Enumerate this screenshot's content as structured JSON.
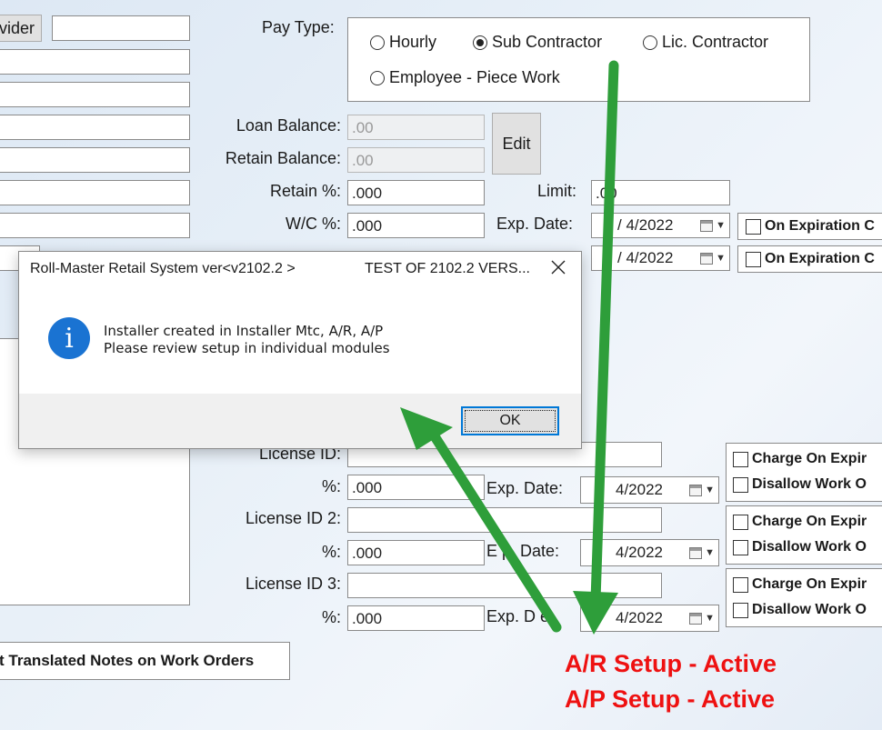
{
  "left": {
    "provider_label": "vider",
    "translated_notes_label": "t Translated Notes on Work Orders"
  },
  "pay_type": {
    "label": "Pay Type:",
    "options": [
      "Hourly",
      "Sub Contractor",
      "Lic. Contractor",
      "Employee - Piece Work"
    ],
    "selected": "Sub Contractor"
  },
  "fields": {
    "loan_balance_label": "Loan Balance:",
    "loan_balance": ".00",
    "retain_balance_label": "Retain Balance:",
    "retain_balance": ".00",
    "edit_label": "Edit",
    "retain_pct_label": "Retain %:",
    "retain_pct": ".000",
    "limit_label": "Limit:",
    "limit": ".00",
    "wc_pct_label": "W/C %:",
    "wc_pct": ".000",
    "exp_date_label": "Exp. Date:",
    "wc_exp_date": "/  4/2022",
    "row2_exp_date": "/  4/2022",
    "on_expiration_1": "On Expiration C",
    "on_expiration_2": "On Expiration C"
  },
  "licenses": {
    "license_id_label": "License ID:",
    "license_id_2_label": "License ID 2:",
    "license_id_3_label": "License ID 3:",
    "pct_label": "%:",
    "pct_1": ".000",
    "pct_2": ".000",
    "pct_3": ".000",
    "exp_date_label": "Exp. Date:",
    "exp_date_2_label": "E   p. Date:",
    "exp_date_3_label": "Exp. D    e:",
    "date_1": "4/2022",
    "date_2": "4/2022",
    "date_3": "4/2022",
    "charge_on_expiry": "Charge On Expir",
    "disallow_work": "Disallow Work O"
  },
  "annotations": {
    "ar_setup": "A/R Setup - Active",
    "ap_setup": "A/P Setup - Active",
    "arrow_color": "#2e9e3a"
  },
  "dialog": {
    "title": "Roll-Master Retail System ver<v2102.2 >",
    "title_right": "TEST OF 2102.2 VERS...",
    "message_line1": "Installer created in Installer Mtc, A/R, A/P",
    "message_line2": "Please review setup in individual modules",
    "ok_label": "OK"
  }
}
